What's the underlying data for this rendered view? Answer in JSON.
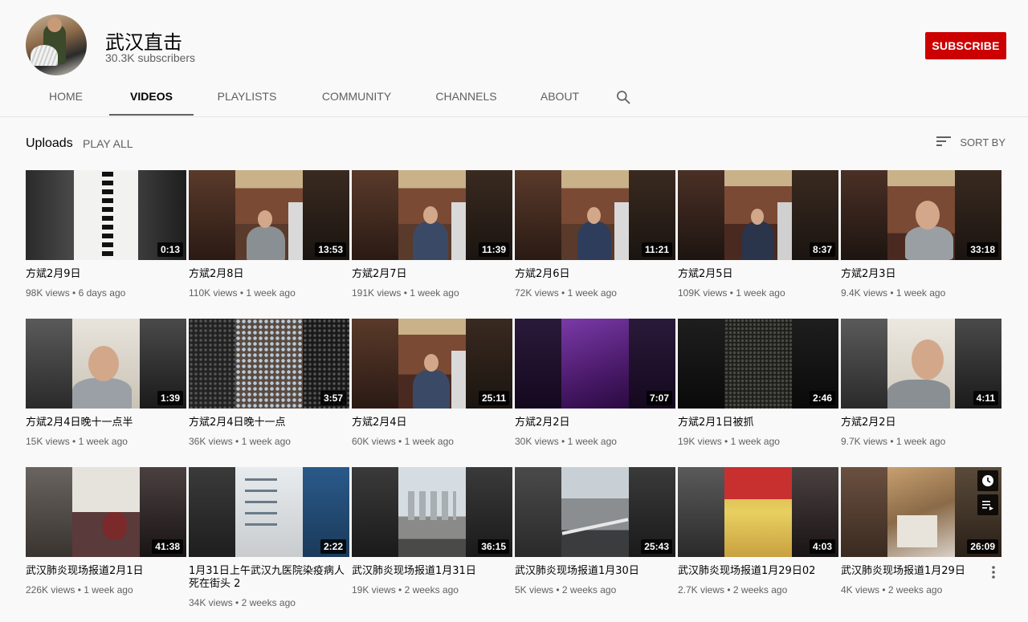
{
  "channel": {
    "name": "武汉直击",
    "subscribers": "30.3K subscribers",
    "subscribe_label": "SUBSCRIBE",
    "accent_color": "#cc0000"
  },
  "tabs": [
    {
      "label": "HOME",
      "active": false
    },
    {
      "label": "VIDEOS",
      "active": true
    },
    {
      "label": "PLAYLISTS",
      "active": false
    },
    {
      "label": "COMMUNITY",
      "active": false
    },
    {
      "label": "CHANNELS",
      "active": false
    },
    {
      "label": "ABOUT",
      "active": false
    }
  ],
  "section": {
    "title": "Uploads",
    "play_all": "PLAY ALL",
    "sort_by": "SORT BY"
  },
  "videos": [
    {
      "title": "方斌2月9日",
      "views": "98K views",
      "age": "6 days ago",
      "duration": "0:13"
    },
    {
      "title": "方斌2月8日",
      "views": "110K views",
      "age": "1 week ago",
      "duration": "13:53"
    },
    {
      "title": "方斌2月7日",
      "views": "191K views",
      "age": "1 week ago",
      "duration": "11:39"
    },
    {
      "title": "方斌2月6日",
      "views": "72K views",
      "age": "1 week ago",
      "duration": "11:21"
    },
    {
      "title": "方斌2月5日",
      "views": "109K views",
      "age": "1 week ago",
      "duration": "8:37"
    },
    {
      "title": "方斌2月3日",
      "views": "9.4K views",
      "age": "1 week ago",
      "duration": "33:18"
    },
    {
      "title": "方斌2月4日晚十一点半",
      "views": "15K views",
      "age": "1 week ago",
      "duration": "1:39"
    },
    {
      "title": "方斌2月4日晚十一点",
      "views": "36K views",
      "age": "1 week ago",
      "duration": "3:57"
    },
    {
      "title": "方斌2月4日",
      "views": "60K views",
      "age": "1 week ago",
      "duration": "25:11"
    },
    {
      "title": "方斌2月2日",
      "views": "30K views",
      "age": "1 week ago",
      "duration": "7:07"
    },
    {
      "title": "方斌2月1日被抓",
      "views": "19K views",
      "age": "1 week ago",
      "duration": "2:46"
    },
    {
      "title": "方斌2月2日",
      "views": "9.7K views",
      "age": "1 week ago",
      "duration": "4:11"
    },
    {
      "title": "武汉肺炎现场报道2月1日",
      "views": "226K views",
      "age": "1 week ago",
      "duration": "41:38"
    },
    {
      "title": "1月31日上午武汉九医院染疫病人死在街头 2",
      "views": "34K views",
      "age": "2 weeks ago",
      "duration": "2:22"
    },
    {
      "title": "武汉肺炎现场报道1月31日",
      "views": "19K views",
      "age": "2 weeks ago",
      "duration": "36:15"
    },
    {
      "title": "武汉肺炎现场报道1月30日",
      "views": "5K views",
      "age": "2 weeks ago",
      "duration": "25:43"
    },
    {
      "title": "武汉肺炎现场报道1月29日02",
      "views": "2.7K views",
      "age": "2 weeks ago",
      "duration": "4:03"
    },
    {
      "title": "武汉肺炎现场报道1月29日",
      "views": "4K views",
      "age": "2 weeks ago",
      "duration": "26:09"
    }
  ],
  "icons": {
    "search": "search-icon",
    "sort": "sort-icon",
    "watch_later": "clock-icon",
    "add_to_queue": "queue-icon",
    "more": "kebab-icon"
  }
}
